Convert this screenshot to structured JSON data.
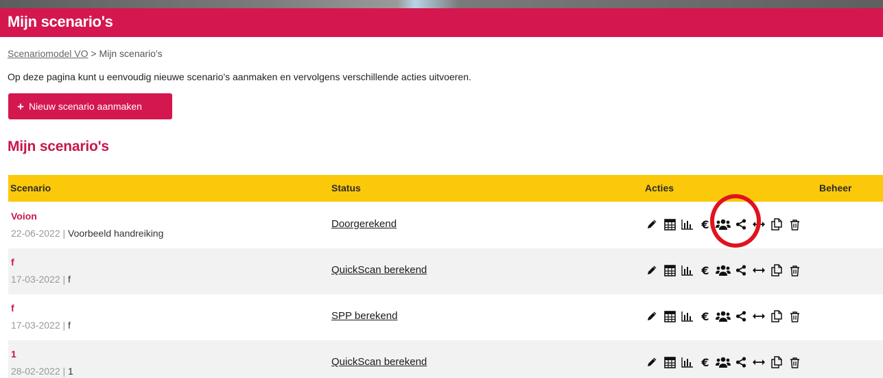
{
  "page": {
    "title": "Mijn scenario's"
  },
  "breadcrumb": {
    "root": "Scenariomodel VO",
    "separator": " > ",
    "current": "Mijn scenario's"
  },
  "intro": "Op deze pagina kunt u eenvoudig nieuwe scenario's aanmaken en vervolgens verschillende acties uitvoeren.",
  "new_button": {
    "icon": "+",
    "label": "Nieuw scenario aanmaken"
  },
  "section_title": "Mijn scenario's",
  "table": {
    "headers": {
      "scenario": "Scenario",
      "status": "Status",
      "acties": "Acties",
      "beheer": "Beheer"
    },
    "rows": [
      {
        "name": "Voion",
        "date": "22-06-2022",
        "sep": " | ",
        "desc": "Voorbeeld handreiking",
        "status": "Doorgerekend"
      },
      {
        "name": "f",
        "date": "17-03-2022",
        "sep": " | ",
        "desc": "f",
        "status": "QuickScan berekend"
      },
      {
        "name": "f",
        "date": "17-03-2022",
        "sep": " | ",
        "desc": "f",
        "status": "SPP berekend"
      },
      {
        "name": "1",
        "date": "28-02-2022",
        "sep": " | ",
        "desc": "1",
        "status": "QuickScan berekend"
      }
    ]
  },
  "action_icons": [
    "pencil-icon",
    "calculator-icon",
    "bar-chart-icon",
    "euro-icon",
    "users-icon",
    "share-icon",
    "compare-arrows-icon",
    "copy-icon",
    "trash-icon"
  ],
  "action_glyphs": {
    "euro": "€"
  },
  "colors": {
    "brand": "#d4174f",
    "header_yellow": "#fcc90a",
    "highlight_circle": "#e0131e"
  }
}
